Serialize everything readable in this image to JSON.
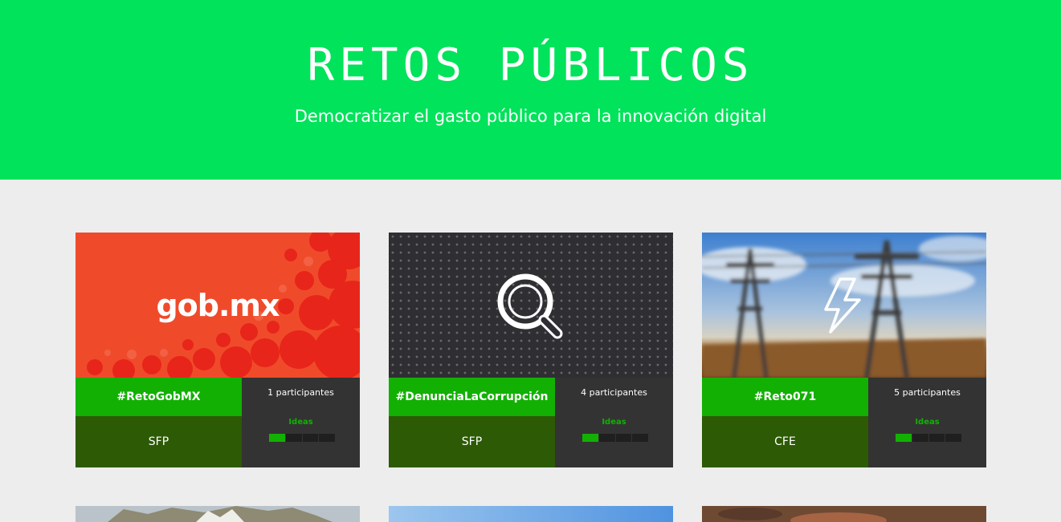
{
  "hero": {
    "title": "RETOS PÚBLICOS",
    "subtitle": "Democratizar el gasto público para la innovación digital",
    "background_color": "#00e35a"
  },
  "colors": {
    "tag_green": "#13b004",
    "org_dark_green": "#2d5a05",
    "stats_gray": "#333333",
    "page_bg": "#ededed"
  },
  "cards": [
    {
      "image_label": "gob.mx",
      "image_icon": "circles-pattern",
      "hashtag": "#RetoGobMX",
      "participants": "1 participantes",
      "stage": "Ideas",
      "stage_progress": 0.2,
      "organization": "SFP"
    },
    {
      "image_icon": "magnifier-icon",
      "hashtag": "#DenunciaLaCorrupción",
      "participants": "4 participantes",
      "stage": "Ideas",
      "stage_progress": 0.2,
      "organization": "SFP"
    },
    {
      "image_icon": "lightning-icon",
      "hashtag": "#Reto071",
      "participants": "5 participantes",
      "stage": "Ideas",
      "stage_progress": 0.2,
      "organization": "CFE"
    }
  ]
}
